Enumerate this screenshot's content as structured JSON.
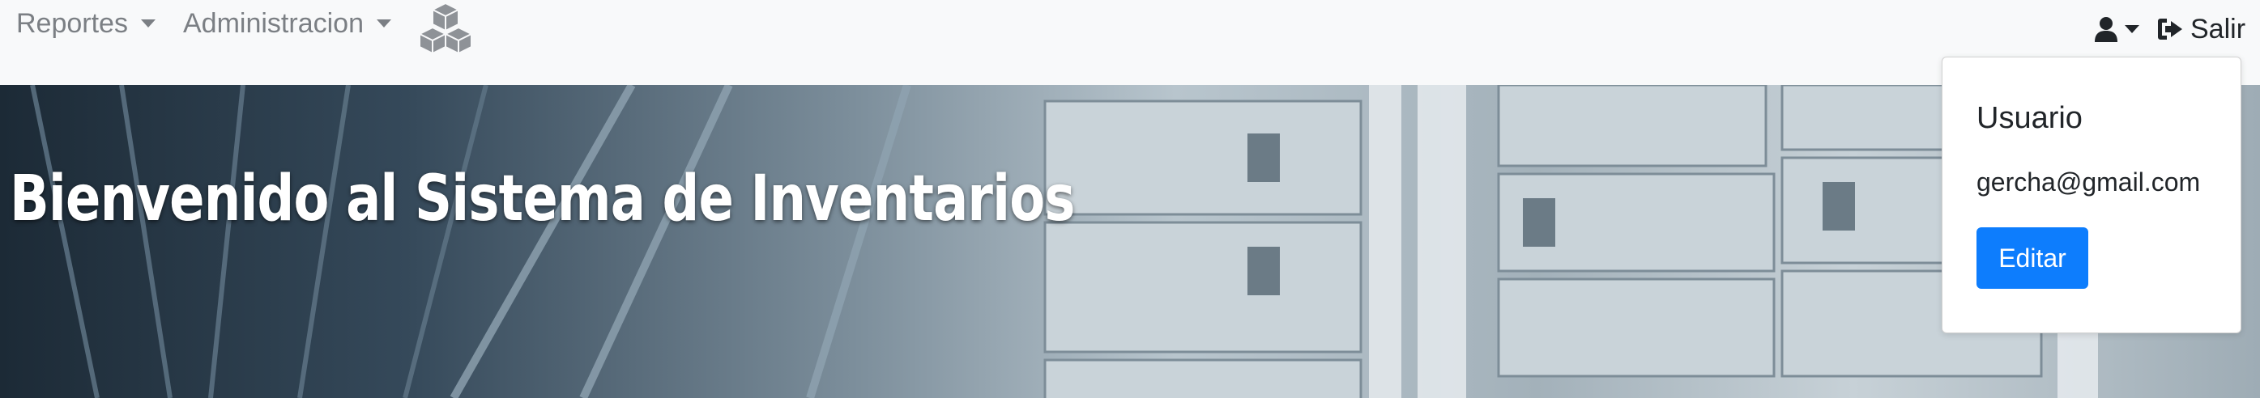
{
  "navbar": {
    "menus": [
      {
        "label": "Reportes"
      },
      {
        "label": "Administracion"
      }
    ],
    "brand_icon": "cubes-icon",
    "user_icon": "user-icon",
    "logout": {
      "label": "Salir",
      "icon": "sign-out-icon"
    }
  },
  "hero": {
    "title": "Bienvenido al Sistema de Inventarios",
    "background": "warehouse shelves photo"
  },
  "user_menu": {
    "header": "Usuario",
    "email": "gercha@gmail.com",
    "edit_label": "Editar"
  },
  "colors": {
    "navbar_bg": "#f8f9fa",
    "primary": "#0d7dfd",
    "nav_text": "#7b7f84"
  }
}
